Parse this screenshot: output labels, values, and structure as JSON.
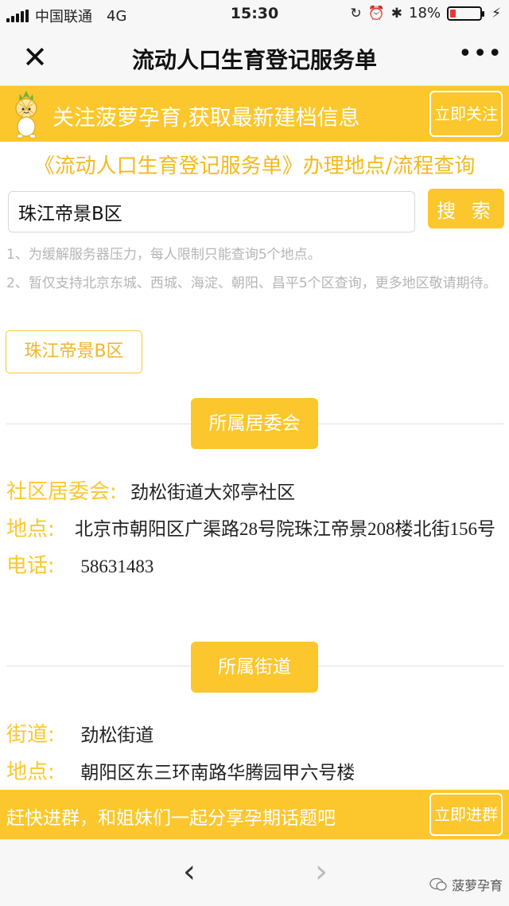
{
  "status_bar": {
    "carrier": "中国联通",
    "network": "4G",
    "time": "15:30",
    "battery_percent": "18%",
    "battery_level": 0.18,
    "icons": [
      "signal-icon",
      "orientation-lock-icon",
      "alarm-icon",
      "bluetooth-icon",
      "battery-icon",
      "charging-icon"
    ]
  },
  "nav": {
    "title": "流动人口生育登记服务单",
    "close_icon": "close-icon",
    "more_icon": "more-icon"
  },
  "follow_banner": {
    "text": "关注菠萝孕育,获取最新建档信息",
    "button_label": "立即关注",
    "mascot_icon": "pineapple-mascot-icon"
  },
  "subtitle": "《流动人口生育登记服务单》办理地点/流程查询",
  "search": {
    "value": "珠江帝景B区",
    "button_label": "搜 索"
  },
  "notes": [
    "1、为缓解服务器压力，每人限制只能查询5个地点。",
    "2、暂仅支持北京东城、西城、海淀、朝阳、昌平5个区查询，更多地区敬请期待。"
  ],
  "history_tag": "珠江帝景B区",
  "committee": {
    "section_label": "所属居委会",
    "rows": [
      {
        "label": "社区居委会:",
        "value": "劲松街道大郊亭社区"
      },
      {
        "label": "地点:",
        "value": "北京市朝阳区广渠路28号院珠江帝景208楼北街156号"
      },
      {
        "label": "电话:",
        "value": "58631483"
      }
    ]
  },
  "street": {
    "section_label": "所属街道",
    "rows": [
      {
        "label": "街道:",
        "value": "劲松街道"
      },
      {
        "label": "地点:",
        "value": "朝阳区东三环南路华腾园甲六号楼"
      }
    ]
  },
  "group_banner": {
    "text": "赶快进群，和姐妹们一起分享孕期话题吧",
    "button_label": "立即进群"
  },
  "toolbar": {
    "back_icon": "back-arrow-icon",
    "forward_icon": "forward-arrow-icon",
    "watermark": "菠萝孕育"
  },
  "colors": {
    "accent": "#fcc72c",
    "accent_text": "#f5b91c",
    "note_text": "#b5b5b5",
    "battery_low": "#e53935"
  }
}
